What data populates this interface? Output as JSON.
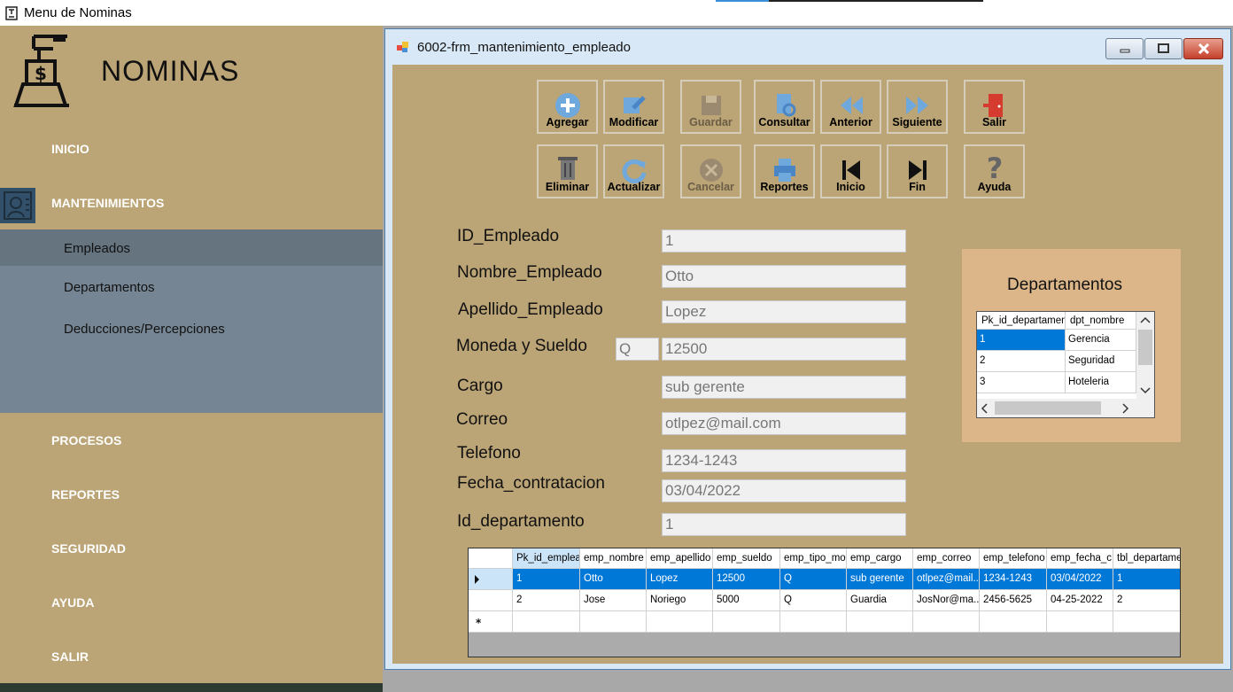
{
  "app": {
    "title": "Menu de Nominas"
  },
  "sidebar": {
    "brand": "NOMINAS",
    "nav": [
      "INICIO",
      "MANTENIMIENTOS",
      "PROCESOS",
      "REPORTES",
      "SEGURIDAD",
      "AYUDA",
      "SALIR"
    ],
    "submenu": [
      "Empleados",
      "Departamentos",
      "Deducciones/Percepciones"
    ]
  },
  "window": {
    "title": "6002-frm_mantenimiento_empleado"
  },
  "toolbar": {
    "agregar": "Agregar",
    "modificar": "Modificar",
    "guardar": "Guardar",
    "consultar": "Consultar",
    "anterior": "Anterior",
    "siguiente": "Siguiente",
    "salir": "Salir",
    "eliminar": "Eliminar",
    "actualizar": "Actualizar",
    "cancelar": "Cancelar",
    "reportes": "Reportes",
    "inicio": "Inicio",
    "fin": "Fin",
    "ayuda": "Ayuda"
  },
  "form": {
    "labels": {
      "id": "ID_Empleado",
      "nombre": "Nombre_Empleado",
      "apellido": "Apellido_Empleado",
      "moneda": "Moneda y Sueldo",
      "cargo": "Cargo",
      "correo": "Correo",
      "telefono": "Telefono",
      "fecha": "Fecha_contratacion",
      "depto": "Id_departamento"
    },
    "values": {
      "id": "1",
      "nombre": "Otto",
      "apellido": "Lopez",
      "moneda": "Q",
      "sueldo": "12500",
      "cargo": "sub gerente",
      "correo": "otlpez@mail.com",
      "telefono": "1234-1243",
      "fecha": "03/04/2022",
      "depto": "1"
    }
  },
  "departamentos": {
    "title": "Departamentos",
    "columns": [
      "Pk_id_departament",
      "dpt_nombre"
    ],
    "rows": [
      [
        "1",
        "Gerencia"
      ],
      [
        "2",
        "Seguridad"
      ],
      [
        "3",
        "Hoteleria"
      ]
    ]
  },
  "empleados_grid": {
    "columns": [
      "Pk_id_emplea",
      "emp_nombre",
      "emp_apellido",
      "emp_sueldo",
      "emp_tipo_mor",
      "emp_cargo",
      "emp_correo",
      "emp_telefono",
      "emp_fecha_c",
      "tbl_departame"
    ],
    "rows": [
      [
        "1",
        "Otto",
        "Lopez",
        "12500",
        "Q",
        "sub gerente",
        "otlpez@mail...",
        "1234-1243",
        "03/04/2022",
        "1"
      ],
      [
        "2",
        "Jose",
        "Noriego",
        "5000",
        "Q",
        "Guardia",
        "JosNor@ma...",
        "2456-5625",
        "04-25-2022",
        "2"
      ]
    ]
  }
}
